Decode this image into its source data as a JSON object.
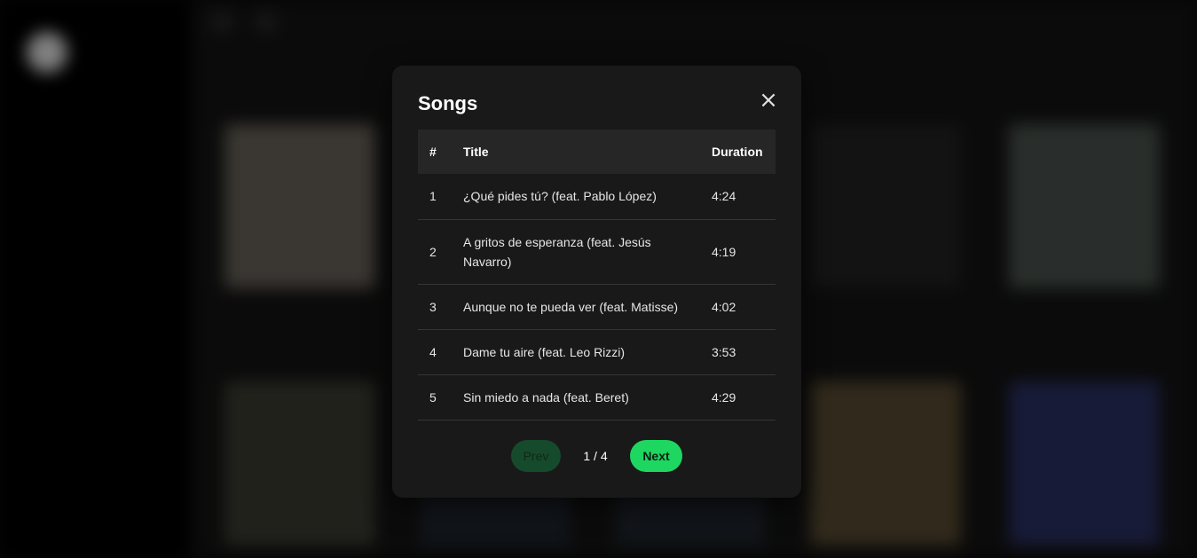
{
  "modal": {
    "title": "Songs",
    "close_symbol": "×",
    "columns": [
      "#",
      "Title",
      "Duration"
    ],
    "rows": [
      {
        "num": "1",
        "title": "¿Qué pides tú? (feat. Pablo López)",
        "duration": "4:24"
      },
      {
        "num": "2",
        "title": "A gritos de esperanza (feat. Jesús Navarro)",
        "duration": "4:19"
      },
      {
        "num": "3",
        "title": "Aunque no te pueda ver (feat. Matisse)",
        "duration": "4:02"
      },
      {
        "num": "4",
        "title": "Dame tu aire (feat. Leo Rizzi)",
        "duration": "3:53"
      },
      {
        "num": "5",
        "title": "Sin miedo a nada (feat. Beret)",
        "duration": "4:29"
      }
    ],
    "pagination": {
      "prev_label": "Prev",
      "page_indicator": "1 / 4",
      "next_label": "Next"
    }
  },
  "colors": {
    "accent": "#1ed760",
    "song_title": "#23c45f",
    "modal_bg": "#191919",
    "header_bg": "#262626"
  }
}
